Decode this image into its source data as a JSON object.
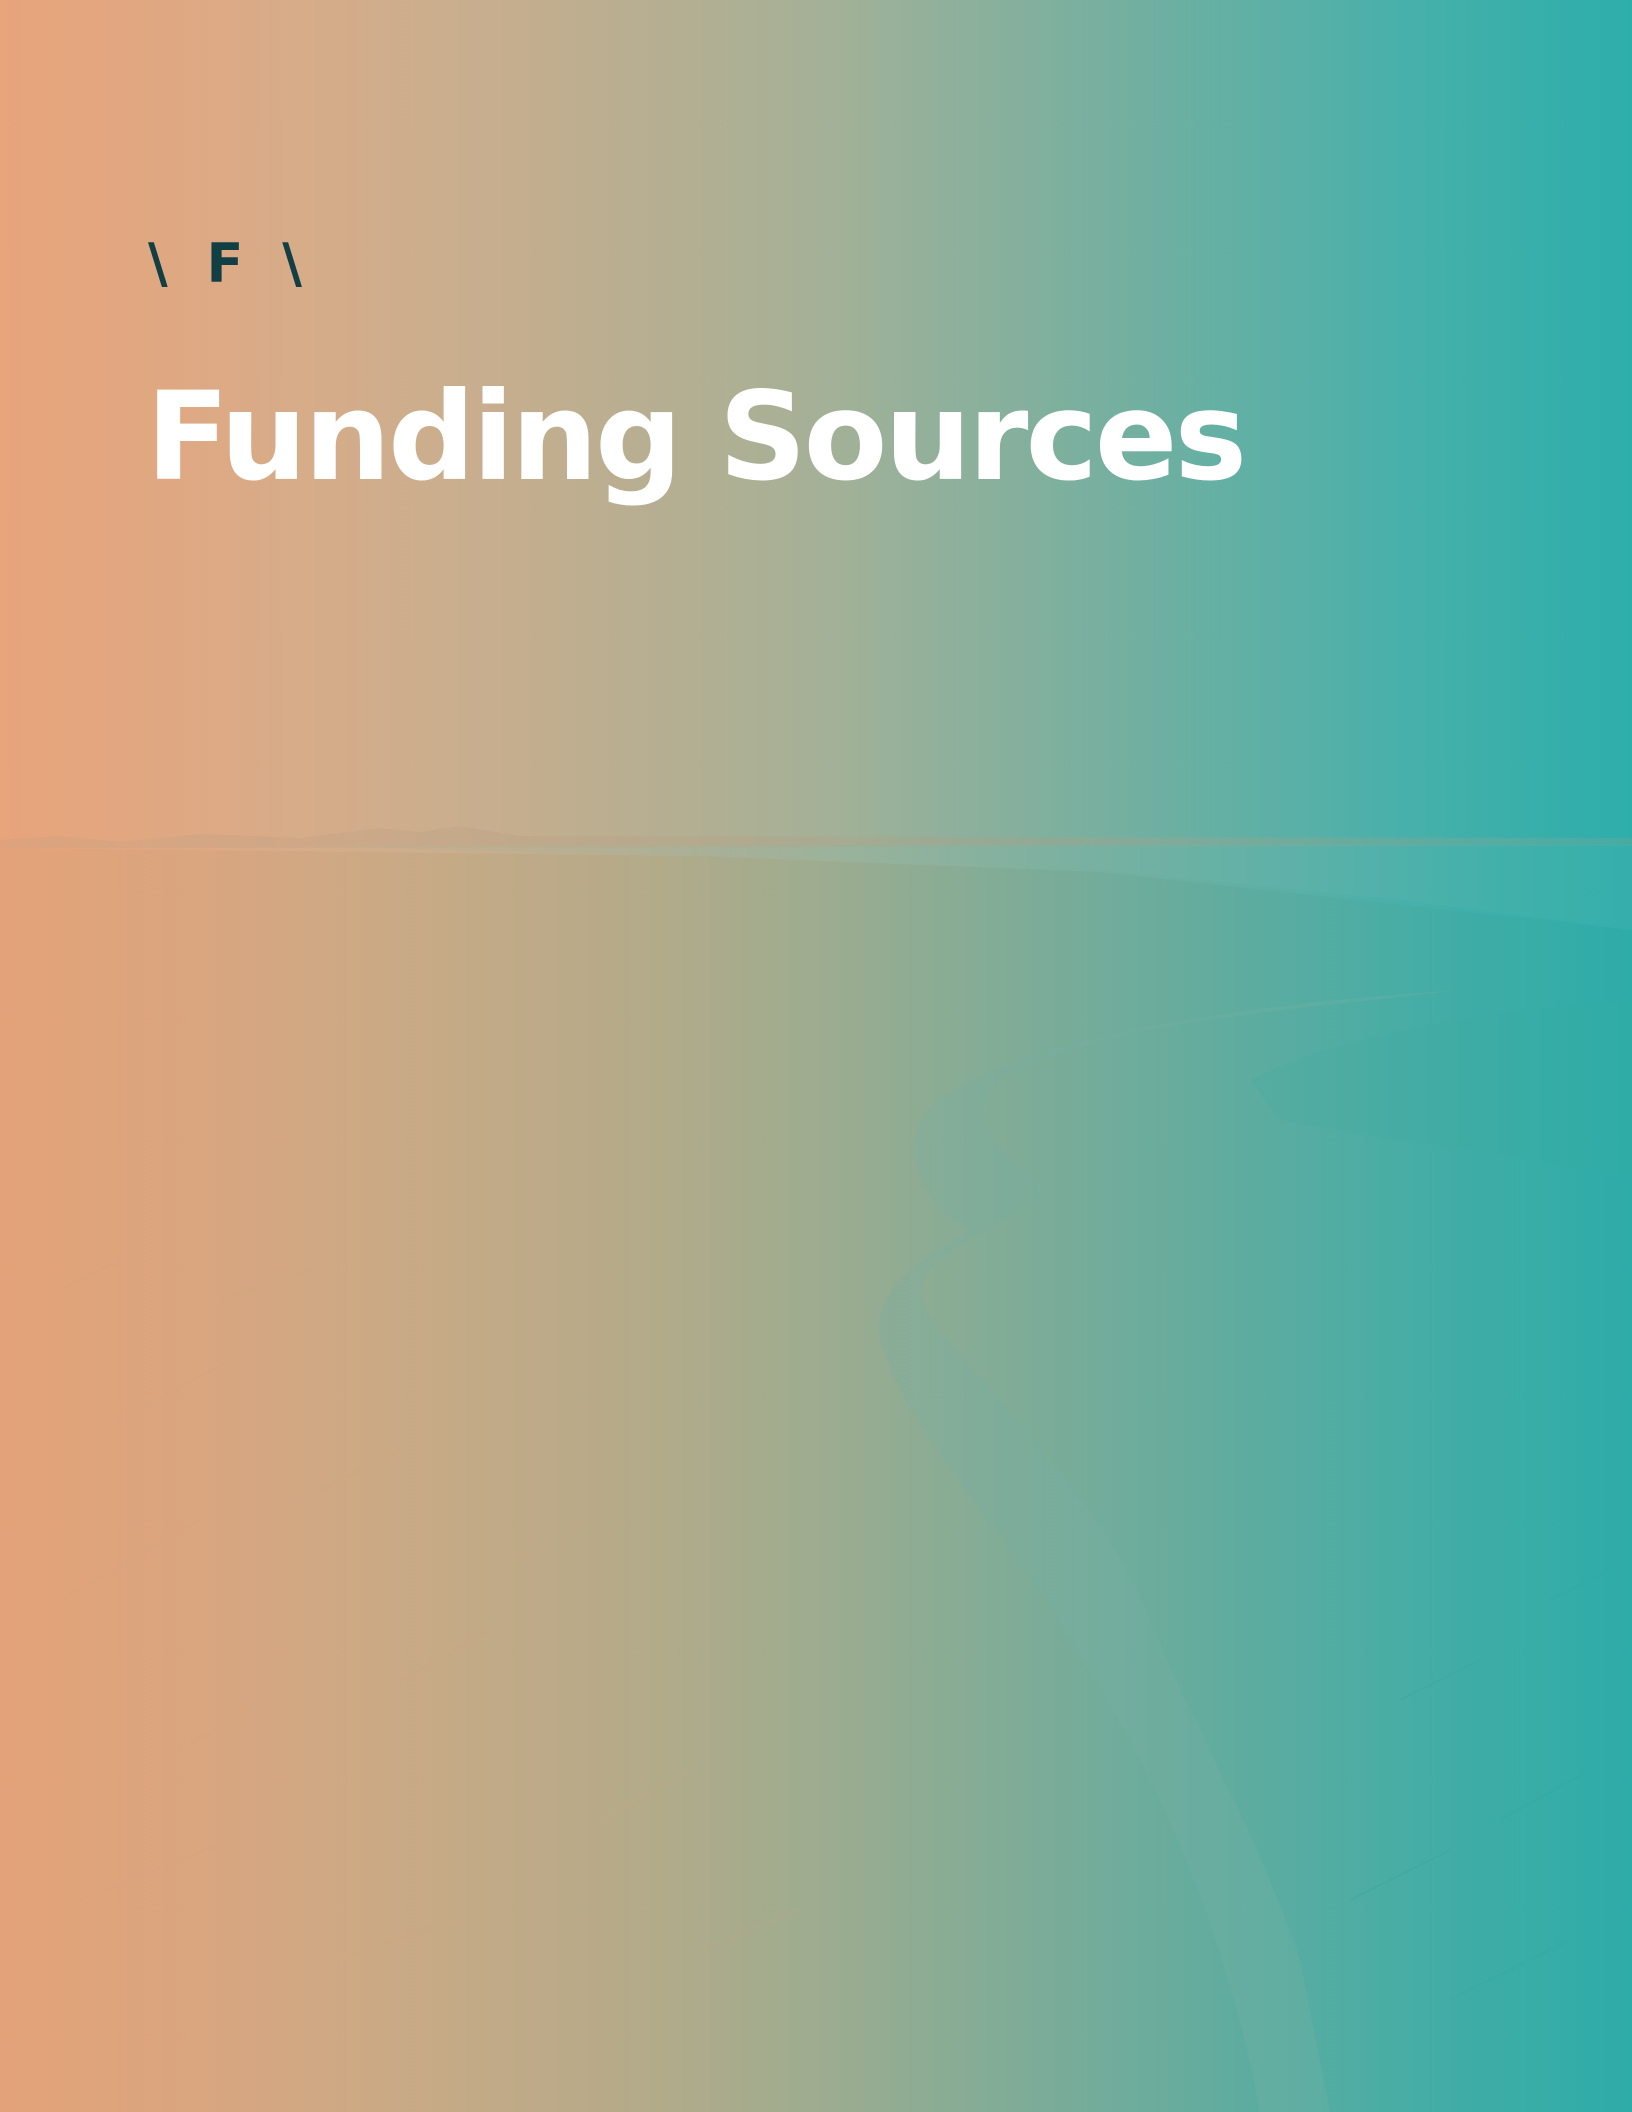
{
  "page": {
    "section_marker": "\\ F \\",
    "title": "Funding Sources"
  },
  "colors": {
    "gradient_left": "#e8a47b",
    "gradient_right": "#2eaeab",
    "marker_color": "#123f44",
    "title_color": "#ffffff"
  },
  "background": {
    "image": "salt-marsh-with-tidal-creek"
  }
}
